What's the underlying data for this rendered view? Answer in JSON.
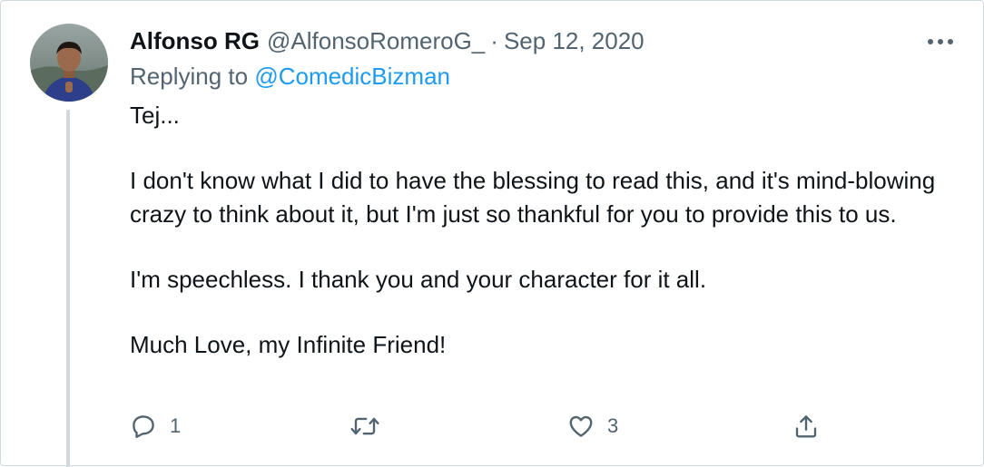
{
  "tweet": {
    "display_name": "Alfonso RG",
    "handle": "@AlfonsoRomeroG_",
    "separator": "·",
    "date": "Sep 12, 2020",
    "replying_prefix": "Replying to ",
    "replying_to": "@ComedicBizman",
    "paragraphs": [
      "Tej...",
      "I don't know what I did to have the blessing to read this, and it's mind-blowing crazy to think about it, but I'm just so thankful for you to provide this to us.",
      "I'm speechless. I thank you and your character for it all.",
      "Much Love, my Infinite Friend!"
    ]
  },
  "actions": {
    "reply_count": "1",
    "retweet_count": "",
    "like_count": "3"
  },
  "icons": {
    "more": "more-horizontal-icon",
    "reply": "reply-bubble-icon",
    "retweet": "retweet-icon",
    "like": "heart-icon",
    "share": "share-icon"
  },
  "colors": {
    "text": "#0f1419",
    "secondary": "#536471",
    "link": "#1d9bf0",
    "thread_line": "#cfd9de"
  }
}
